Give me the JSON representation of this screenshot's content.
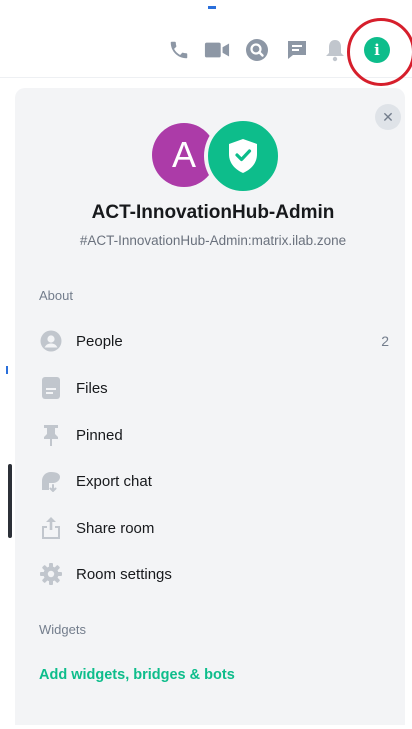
{
  "header": {
    "icons": [
      "phone-icon",
      "video-icon",
      "search-icon",
      "threads-icon",
      "bell-icon",
      "info-icon"
    ],
    "info_glyph": "i"
  },
  "room": {
    "avatar_letter": "A",
    "name": "ACT-InnovationHub-Admin",
    "alias": "#ACT-InnovationHub-Admin:matrix.ilab.zone"
  },
  "about": {
    "heading": "About",
    "items": [
      {
        "label": "People",
        "count": "2",
        "icon": "person-icon"
      },
      {
        "label": "Files",
        "icon": "file-icon"
      },
      {
        "label": "Pinned",
        "icon": "pin-icon"
      },
      {
        "label": "Export chat",
        "icon": "export-icon"
      },
      {
        "label": "Share room",
        "icon": "share-icon"
      },
      {
        "label": "Room settings",
        "icon": "gear-icon"
      }
    ]
  },
  "widgets": {
    "heading": "Widgets",
    "add_label": "Add widgets, bridges & bots"
  },
  "close_glyph": "✕",
  "colors": {
    "accent": "#0dbd8b",
    "avatar": "#ac3ba8",
    "highlight": "#d61f2c",
    "panel": "#f3f4f6"
  }
}
